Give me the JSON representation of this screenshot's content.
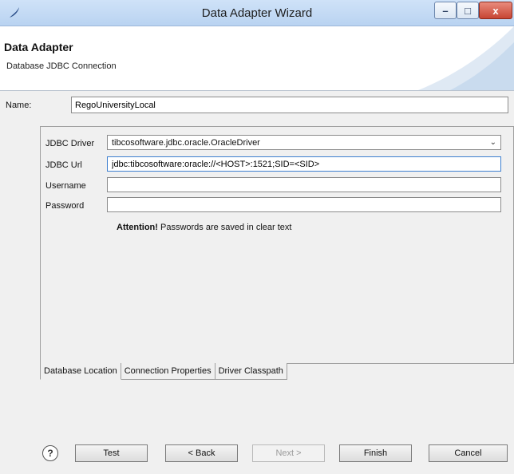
{
  "window": {
    "title": "Data Adapter Wizard",
    "minimize_glyph": "–",
    "maximize_glyph": "□",
    "close_glyph": "x",
    "icon": "eclipse-app-icon"
  },
  "header": {
    "title": "Data Adapter",
    "subtitle": "Database JDBC Connection"
  },
  "name": {
    "label": "Name:",
    "value": "RegoUniversityLocal"
  },
  "form": {
    "driver_label": "JDBC Driver",
    "driver_value": "tibcosoftware.jdbc.oracle.OracleDriver",
    "url_label": "JDBC Url",
    "url_value": "jdbc:tibcosoftware:oracle://<HOST>:1521;SID=<SID>",
    "username_label": "Username",
    "username_value": "",
    "password_label": "Password",
    "password_value": "",
    "attention_strong": "Attention!",
    "attention_text": " Passwords are saved in clear text"
  },
  "tabs": [
    {
      "label": "Database Location"
    },
    {
      "label": "Connection Properties"
    },
    {
      "label": "Driver Classpath"
    }
  ],
  "buttons": {
    "help": "?",
    "test": "Test",
    "back": "< Back",
    "next": "Next >",
    "finish": "Finish",
    "cancel": "Cancel"
  }
}
